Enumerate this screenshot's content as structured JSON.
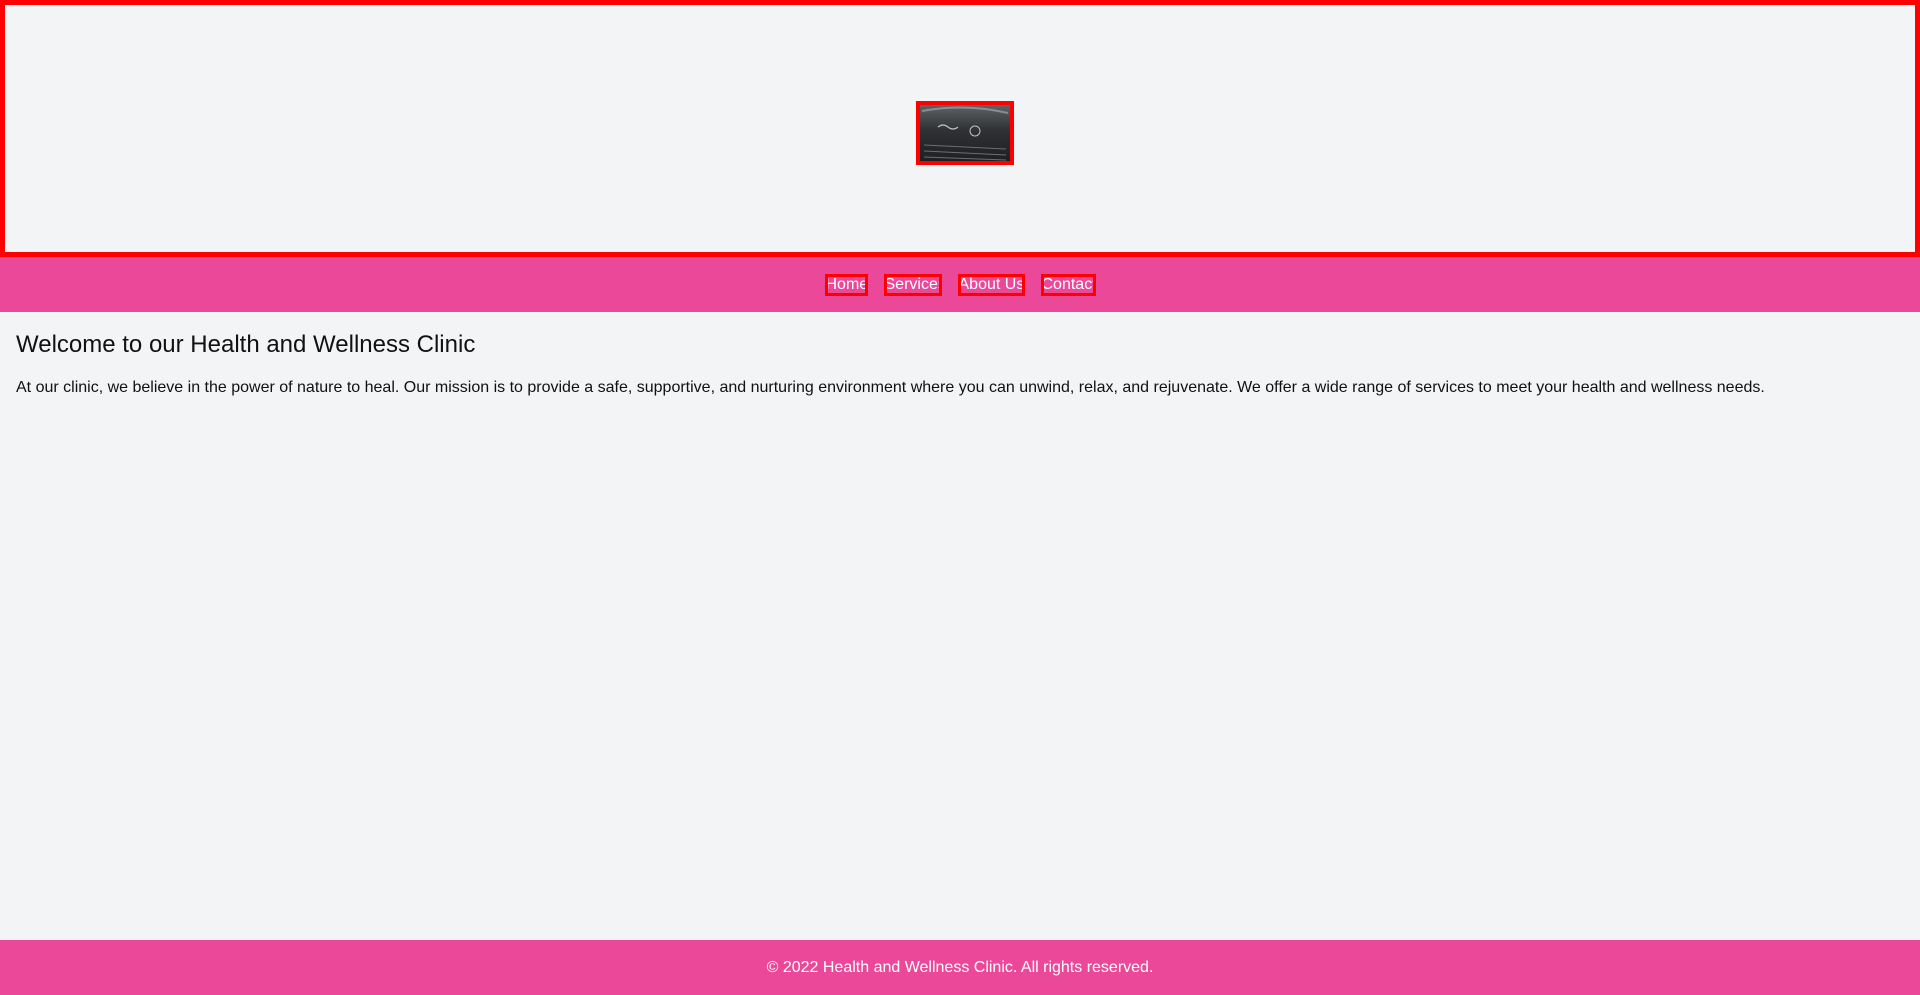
{
  "header": {
    "logo_icon": "logo-image"
  },
  "nav": {
    "items": [
      {
        "label": "Home"
      },
      {
        "label": "Services"
      },
      {
        "label": "About Us"
      },
      {
        "label": "Contact"
      }
    ]
  },
  "main": {
    "heading": "Welcome to our Health and Wellness Clinic",
    "paragraph": "At our clinic, we believe in the power of nature to heal. Our mission is to provide a safe, supportive, and nurturing environment where you can unwind, relax, and rejuvenate. We offer a wide range of services to meet your health and wellness needs."
  },
  "footer": {
    "text": "© 2022 Health and Wellness Clinic. All rights reserved."
  },
  "colors": {
    "accent": "#ec4899",
    "outline": "#ff0000",
    "background": "#f3f4f6"
  }
}
